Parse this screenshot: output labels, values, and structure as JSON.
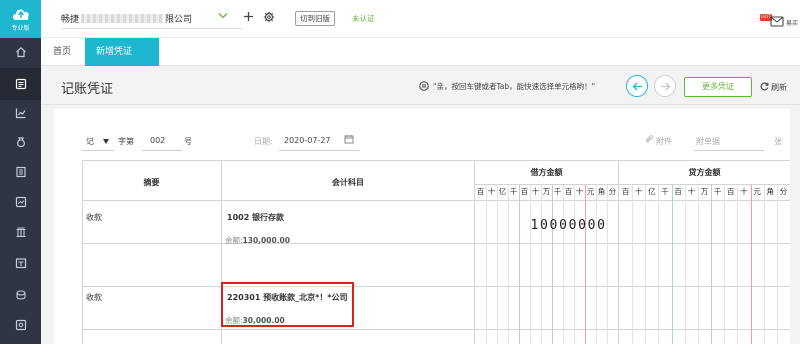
{
  "app": {
    "brand_label": "专业版",
    "company_prefix": "畅捷",
    "company_suffix": "限公司",
    "switch_label": "切到旧版",
    "verify_status": "未认证",
    "hot_badge": "HOT",
    "message_label": "易买"
  },
  "tabs": [
    {
      "label": "首页"
    },
    {
      "label": "新增凭证",
      "close": "×"
    }
  ],
  "header": {
    "title": "记账凭证",
    "tip": "\"亲，按回车键或者Tab，能快速选择单元格哟！\"",
    "more_label": "更多凭证",
    "refresh_label": "刷新"
  },
  "voucher": {
    "type": "记",
    "word_label": "字第",
    "number": "002",
    "number_suffix": "号",
    "date_label": "日期:",
    "date": "2020-07-27",
    "attachment_label": "附件",
    "attach_count_placeholder": "附单据",
    "attach_unit": "张"
  },
  "table": {
    "col_summary": "摘要",
    "col_account": "会计科目",
    "col_debit": "借方金额",
    "col_credit": "贷方金额",
    "digit_units": [
      "百",
      "十",
      "亿",
      "千",
      "百",
      "十",
      "万",
      "千",
      "百",
      "十",
      "元",
      "角",
      "分"
    ],
    "rows": [
      {
        "summary": "收款",
        "account": "1002 银行存款",
        "balance_label": "余额:",
        "balance": "130,000.00",
        "debit": "10000000"
      },
      {
        "summary": "收款",
        "account": "220301 预收账款_北京*！*公司",
        "balance_label": "余额:",
        "balance": "30,000.00",
        "debit": ""
      },
      {
        "summary": "",
        "account": "",
        "balance_label": "",
        "balance": "",
        "debit": ""
      },
      {
        "summary": "",
        "account": "",
        "balance_label": "",
        "balance": "",
        "debit": ""
      }
    ]
  },
  "colors": {
    "accent": "#1fb6cf",
    "green": "#67b53a",
    "sidebar": "#2f3542",
    "highlight_border": "#e0201b"
  }
}
